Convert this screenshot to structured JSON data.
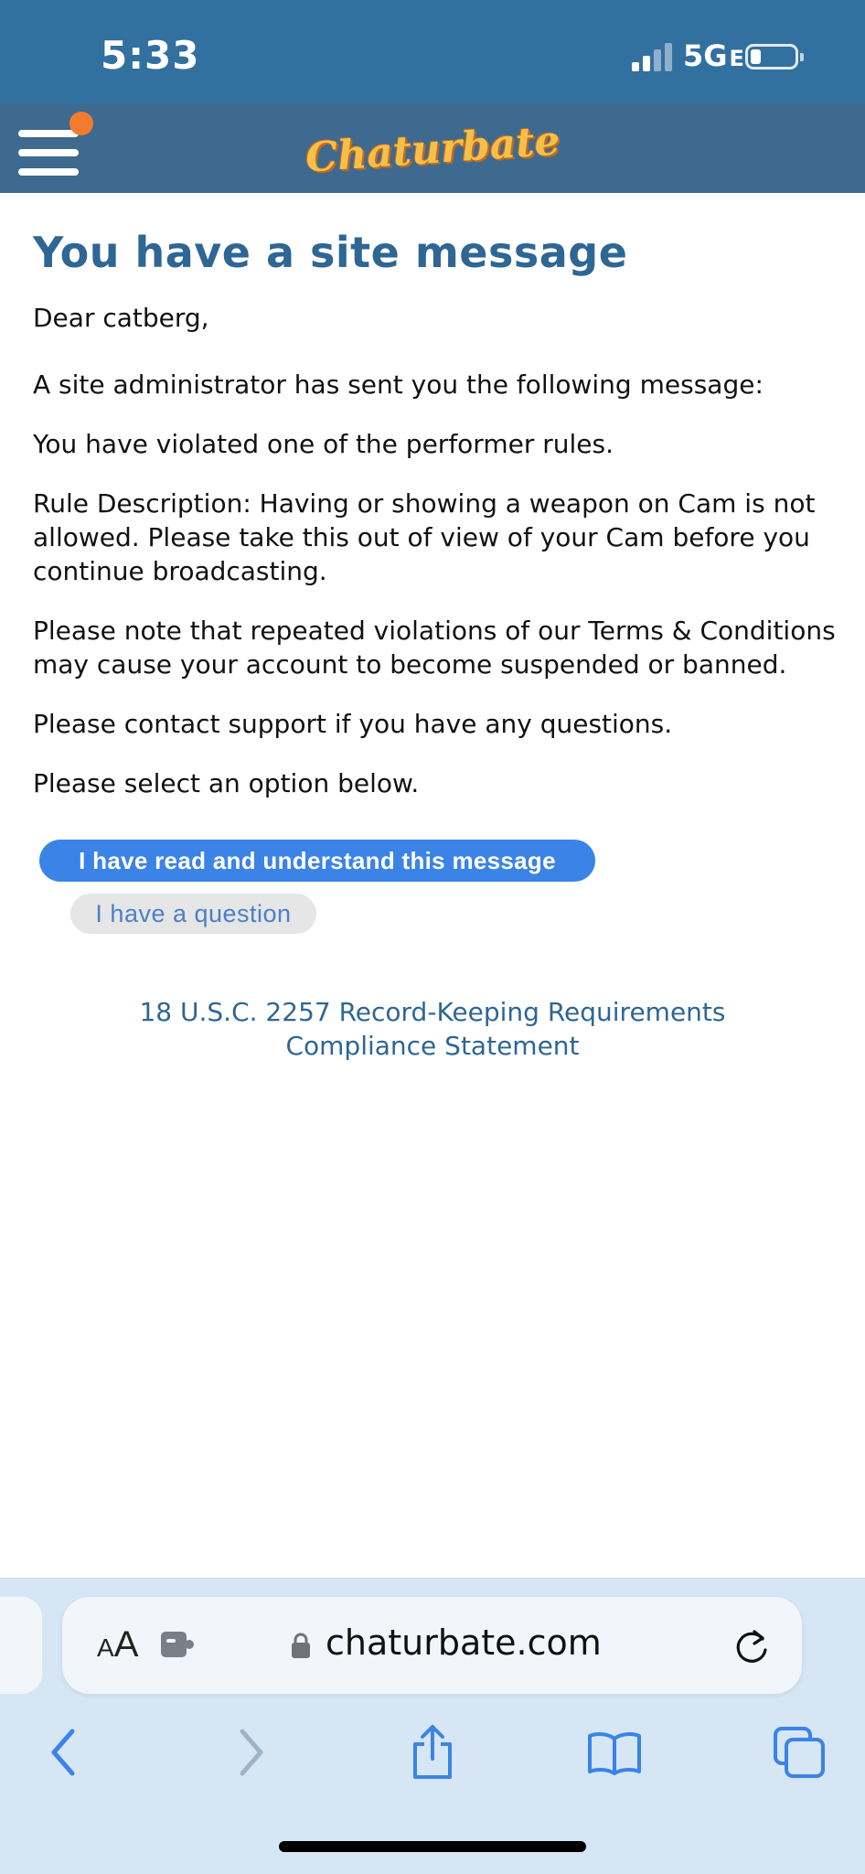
{
  "status_bar": {
    "time": "5:33",
    "network": "5G",
    "network_suffix": "E"
  },
  "header": {
    "logo_text": "Chaturbate",
    "menu_icon": "hamburger-icon",
    "notification_dot_color": "#f27c2d"
  },
  "message": {
    "title": "You have a site message",
    "greeting": "Dear catberg,",
    "paragraphs": [
      "A site administrator has sent you the following message:",
      "You have violated one of the performer rules.",
      "Rule Description: Having or showing a weapon on Cam is not allowed. Please take this out of view of your Cam before you continue broadcasting.",
      "Please note that repeated violations of our Terms & Conditions may cause your account to become suspended or banned.",
      "Please contact support if you have any questions.",
      "Please select an option below."
    ]
  },
  "actions": {
    "primary_label": "I have read and understand this message",
    "secondary_label": "I have a question"
  },
  "footer": {
    "compliance_line1": "18 U.S.C. 2257 Record-Keeping Requirements",
    "compliance_line2": "Compliance Statement"
  },
  "browser": {
    "aa_small": "A",
    "aa_big": "A",
    "url": "chaturbate.com",
    "icons": [
      "puzzle-icon",
      "lock-icon",
      "reload-icon",
      "back-icon",
      "forward-icon",
      "share-icon",
      "bookmarks-icon",
      "tabs-icon"
    ]
  },
  "colors": {
    "status_bar_bg": "#32709f",
    "header_bg": "#3f6a8f",
    "title_color": "#2e6694",
    "primary_button": "#3b83e6",
    "secondary_button_bg": "#e6e6e6",
    "secondary_button_text": "#4a7fca",
    "browser_bar_bg": "#d6e6f4"
  }
}
